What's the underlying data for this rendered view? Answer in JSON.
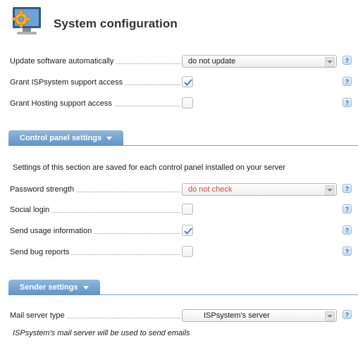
{
  "header": {
    "title": "System configuration",
    "icon": "gear-monitor-icon"
  },
  "general": [
    {
      "label": "Update software automatically",
      "type": "select",
      "value": "do not update"
    },
    {
      "label": "Grant ISPsystem support access",
      "type": "checkbox",
      "checked": true
    },
    {
      "label": "Grant Hosting support access",
      "type": "checkbox",
      "checked": false
    }
  ],
  "control_panel": {
    "title": "Control panel settings",
    "description": "Settings of this section are saved for each control panel installed on your server",
    "fields": [
      {
        "label": "Password strength",
        "type": "select",
        "value": "do not check",
        "value_color": "#d04a3a"
      },
      {
        "label": "Social login",
        "type": "checkbox",
        "checked": false
      },
      {
        "label": "Send usage information",
        "type": "checkbox",
        "checked": true
      },
      {
        "label": "Send bug reports",
        "type": "checkbox",
        "checked": false
      }
    ]
  },
  "sender": {
    "title": "Sender settings",
    "fields": [
      {
        "label": "Mail server type",
        "type": "select",
        "value": "ISPsystem's server"
      }
    ],
    "hint": "ISPsystem's mail server will be used to send emails"
  },
  "help_label": "?",
  "colors": {
    "tab": "#6a9bcc",
    "accent": "#5f93c7",
    "warning_text": "#d04a3a"
  }
}
